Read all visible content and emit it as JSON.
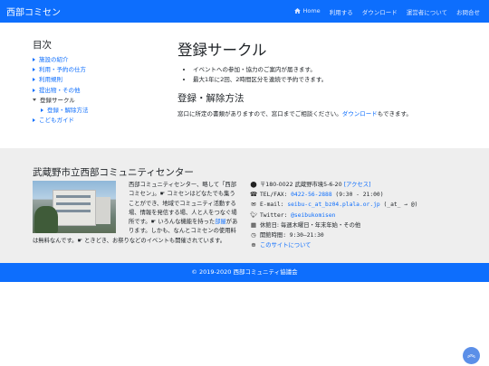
{
  "nav": {
    "brand": "西部コミセン",
    "links": [
      "Home",
      "利用する",
      "ダウンロード",
      "運営者について",
      "お問合せ"
    ]
  },
  "sidebar": {
    "title": "目次",
    "items": [
      {
        "label": "施設の紹介"
      },
      {
        "label": "利用・予約の仕方"
      },
      {
        "label": "利用規則"
      },
      {
        "label": "提出物・その他"
      },
      {
        "label": "登録サークル"
      },
      {
        "label": "登録・解除方法"
      },
      {
        "label": "こどもガイド"
      }
    ]
  },
  "main": {
    "title": "登録サークル",
    "bullets": [
      "イベントへの参加・協力のご案内が届きます。",
      "最大1年に2回、2時間区分を連続で予約できます。"
    ],
    "section_title": "登録・解除方法",
    "para_before": "窓口に所定の書類がありますので、窓口までご相談ください。",
    "para_link": "ダウンロード",
    "para_after": "もできます。"
  },
  "footer": {
    "title": "武蔵野市立西部コミュニティセンター",
    "desc1": "西部コミュニティセンター、略して「西部コミセン」。",
    "desc2": " コミセンはどなたでも集うことができ、地域でコミュニティ活動する場、情報を発信する場、人と人をつなぐ場所です。",
    "desc3": " いろんな機能を持った",
    "desc_hl": "部屋",
    "desc4": "があります。しかも、なんとコミセンの使用料は無料なんです。",
    "desc5": " ときどき、お祭りなどのイベントも開催されています。",
    "address": "〒180-0022 武蔵野市境5-6-20",
    "access": "[アクセス]",
    "tel_label": "TEL/FAX: ",
    "tel": "0422-56-2888",
    "tel_hours": " (9:30 - 21:00)",
    "email_label": "E-mail: ",
    "email": "seibu-c_at_bz04.plala.or.jp",
    "email_note": " (_at_ → @)",
    "twitter_label": "Twitter: ",
    "twitter": "@seibukomisen",
    "closed": "休館日: 毎週木曜日・年末年始・その他",
    "hours": "開館時間: 9:30–21:30",
    "about_link": "このサイトについて",
    "copyright": "© 2019-2020 西部コミュニティ協議会"
  }
}
